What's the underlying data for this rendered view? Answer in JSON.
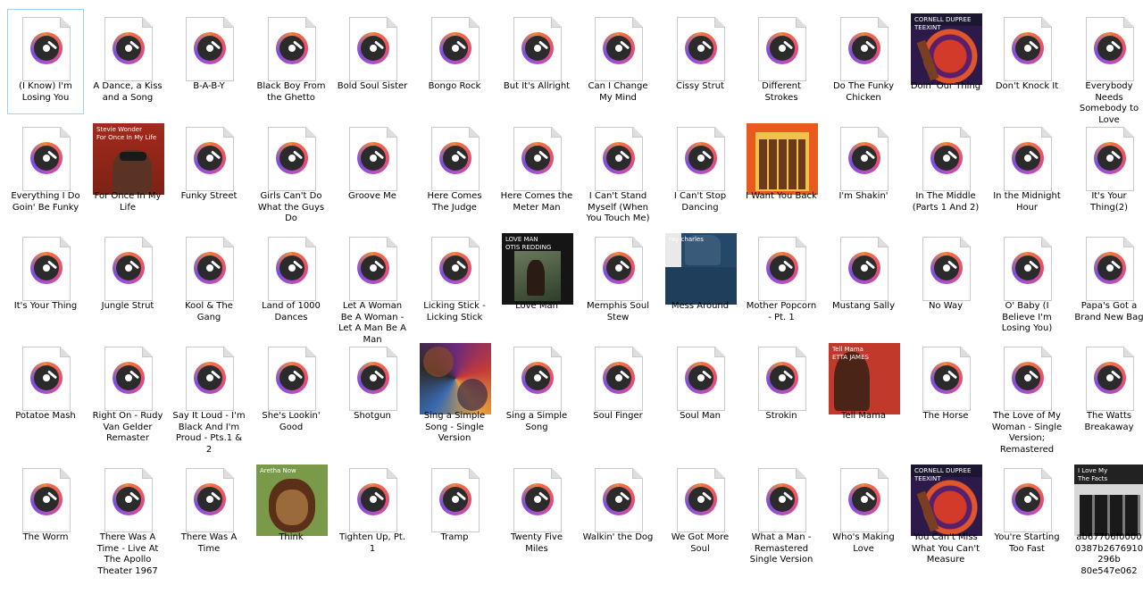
{
  "items": [
    {
      "label": "(I Know) I'm Losing You",
      "selected": true
    },
    {
      "label": "A Dance, a Kiss and a Song"
    },
    {
      "label": "B-A-B-Y"
    },
    {
      "label": "Black Boy From the Ghetto"
    },
    {
      "label": "Bold Soul Sister"
    },
    {
      "label": "Bongo Rock"
    },
    {
      "label": "But It's Allright"
    },
    {
      "label": "Can I Change My Mind"
    },
    {
      "label": "Cissy Strut"
    },
    {
      "label": "Different Strokes"
    },
    {
      "label": "Do The Funky Chicken"
    },
    {
      "label": "Doin' Our Thing",
      "cover": "cornell-dupree",
      "cover_text": [
        "CORNELL DUPREE",
        "TEEXINT"
      ]
    },
    {
      "label": "Don't Knock It"
    },
    {
      "label": "Everybody Needs Somebody to Love"
    },
    {
      "label": "Everything I Do Goin' Be Funky"
    },
    {
      "label": "For Once In My Life",
      "cover": "stevie-wonder",
      "cover_text": [
        "Stevie Wonder",
        "For Once In My Life"
      ]
    },
    {
      "label": "Funky Street"
    },
    {
      "label": "Girls Can't Do What the Guys Do"
    },
    {
      "label": "Groove Me"
    },
    {
      "label": "Here Comes The Judge"
    },
    {
      "label": "Here Comes the Meter Man"
    },
    {
      "label": "I Can't Stand Myself (When You Touch Me)"
    },
    {
      "label": "I Can't Stop Dancing"
    },
    {
      "label": "I Want You Back",
      "cover": "jackson-5"
    },
    {
      "label": "I'm Shakin'"
    },
    {
      "label": "In The Middle (Parts 1 And 2)"
    },
    {
      "label": "In the Midnight Hour"
    },
    {
      "label": "It's Your Thing(2)"
    },
    {
      "label": "It's Your Thing"
    },
    {
      "label": "Jungle Strut"
    },
    {
      "label": "Kool & The Gang"
    },
    {
      "label": "Land of 1000 Dances"
    },
    {
      "label": "Let A Woman Be A Woman - Let A Man Be A Man"
    },
    {
      "label": "Licking Stick - Licking Stick"
    },
    {
      "label": "Love Man",
      "cover": "otis-redding",
      "cover_text": [
        "LOVE MAN",
        "OTIS REDDING"
      ]
    },
    {
      "label": "Memphis Soul Stew"
    },
    {
      "label": "Mess Around",
      "cover": "ray-charles",
      "cover_text": [
        "ray charles"
      ]
    },
    {
      "label": "Mother Popcorn - Pt. 1"
    },
    {
      "label": "Mustang Sally"
    },
    {
      "label": "No Way"
    },
    {
      "label": "O' Baby (I Believe I'm Losing You)"
    },
    {
      "label": "Papa's Got a Brand New Bag"
    },
    {
      "label": "Potatoe Mash"
    },
    {
      "label": "Right On - Rudy Van Gelder Remaster"
    },
    {
      "label": "Say It Loud - I'm Black And I'm Proud - Pts.1 & 2"
    },
    {
      "label": "She's Lookin' Good"
    },
    {
      "label": "Shotgun"
    },
    {
      "label": "Sing a Simple Song - Single Version",
      "cover": "sly-family"
    },
    {
      "label": "Sing a Simple Song"
    },
    {
      "label": "Soul Finger"
    },
    {
      "label": "Soul Man"
    },
    {
      "label": "Strokin"
    },
    {
      "label": "Tell Mama",
      "cover": "etta-james",
      "cover_text": [
        "Tell Mama",
        "ETTA JAMES"
      ]
    },
    {
      "label": "The Horse"
    },
    {
      "label": "The Love of My Woman - Single Version; Remastered"
    },
    {
      "label": "The Watts Breakaway"
    },
    {
      "label": "The Worm"
    },
    {
      "label": "There Was A Time - Live At The Apollo Theater 1967"
    },
    {
      "label": "There Was A Time"
    },
    {
      "label": "Think",
      "cover": "aretha-now",
      "cover_text": [
        "Aretha Now"
      ]
    },
    {
      "label": "Tighten Up, Pt. 1"
    },
    {
      "label": "Tramp"
    },
    {
      "label": "Twenty Five Miles"
    },
    {
      "label": "Walkin' the Dog"
    },
    {
      "label": "We Got More Soul"
    },
    {
      "label": "What a Man - Remastered Single Version"
    },
    {
      "label": "Who's Making Love"
    },
    {
      "label": "You Can't Miss What You Can't Measure",
      "cover": "cornell-dupree",
      "cover_text": [
        "CORNELL DUPREE",
        "TEEXINT"
      ]
    },
    {
      "label": "You're Starting Too Fast"
    },
    {
      "label": "ab67706f0000 0387b2676910296b 80e547e062",
      "cover": "i-love-my",
      "cover_text": [
        "I Love My",
        "The Facts"
      ]
    }
  ]
}
